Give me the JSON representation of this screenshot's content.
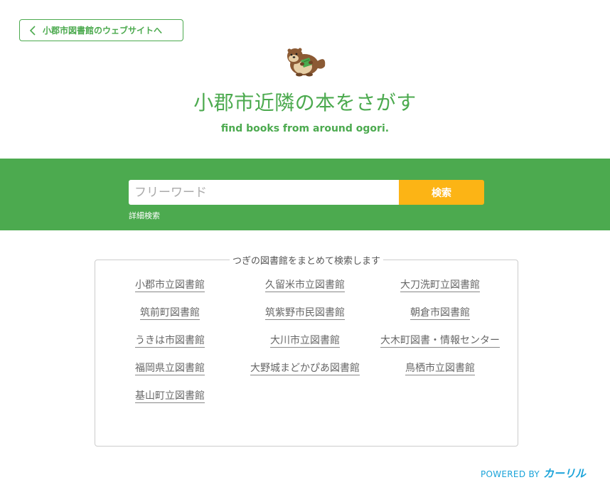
{
  "header": {
    "back_link_label": "小郡市図書館のウェブサイトへ",
    "title": "小郡市近隣の本をさがす",
    "subtitle": "find books from around ogori."
  },
  "search": {
    "placeholder": "フリーワード",
    "value": "",
    "button_label": "検索",
    "advanced_label": "詳細検索"
  },
  "libraries": {
    "heading": "つぎの図書館をまとめて検索します",
    "items": [
      "小郡市立図書館",
      "久留米市立図書館",
      "大刀洗町立図書館",
      "筑前町図書館",
      "筑紫野市民図書館",
      "朝倉市図書館",
      "うきは市図書館",
      "大川市立図書館",
      "大木町図書・情報センター",
      "福岡県立図書館",
      "大野城まどかぴあ図書館",
      "鳥栖市立図書館",
      "基山町立図書館"
    ]
  },
  "footer": {
    "powered_by": "POWERED BY",
    "brand": "カーリル"
  },
  "colors": {
    "accent_green": "#4caa4f",
    "search_button": "#fcb415",
    "brand_blue": "#1aa3d9"
  },
  "icons": {
    "back": "chevron-left-icon",
    "mascot": "otter-mascot"
  }
}
